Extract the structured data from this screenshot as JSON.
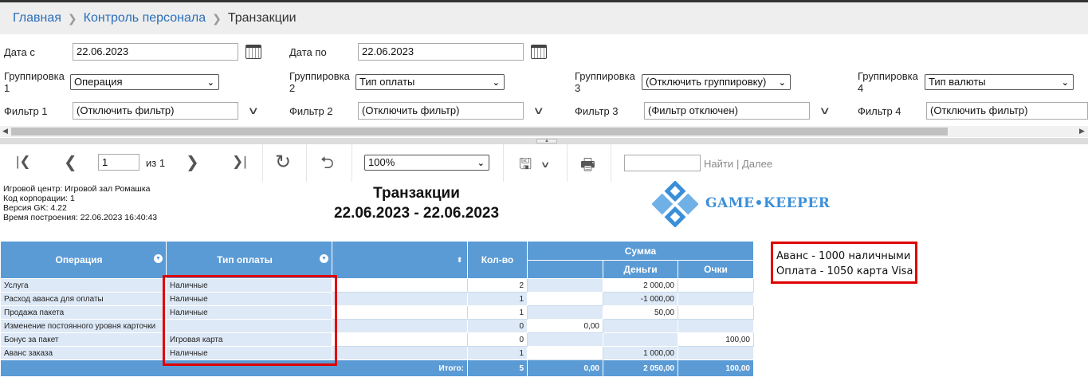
{
  "breadcrumb": {
    "home": "Главная",
    "section": "Контроль персонала",
    "current": "Транзакции"
  },
  "params": {
    "date_from_label": "Дата с",
    "date_from": "22.06.2023",
    "date_to_label": "Дата по",
    "date_to": "22.06.2023",
    "groupings": [
      {
        "label_a": "Группировка",
        "label_b": "1",
        "value": "Операция"
      },
      {
        "label_a": "Группировка",
        "label_b": "2",
        "value": "Тип оплаты"
      },
      {
        "label_a": "Группировка",
        "label_b": "3",
        "value": "(Отключить группировку)"
      },
      {
        "label_a": "Группировка",
        "label_b": "4",
        "value": "Тип валюты"
      }
    ],
    "filters": [
      {
        "label": "Фильтр 1",
        "value": "(Отключить фильтр)"
      },
      {
        "label": "Фильтр 2",
        "value": "(Отключить фильтр)"
      },
      {
        "label": "Фильтр 3",
        "value": "(Фильтр отключен)"
      },
      {
        "label": "Фильтр 4",
        "value": "(Отключить фильтр)"
      }
    ]
  },
  "toolbar": {
    "page": "1",
    "page_of": "из 1",
    "zoom": "100%",
    "find": "Найти",
    "find_sep": "|",
    "next": "Далее"
  },
  "report": {
    "club": "Игровой центр: Игровой зал Ромашка",
    "corp": "Код корпорации: 1",
    "version": "Версия GK: 4.22",
    "built": "Время построения: 22.06.2023 16:40:43",
    "title": "Транзакции",
    "period": "22.06.2023 - 22.06.2023",
    "logo": "GAME•KEEPER",
    "columns": {
      "operation": "Операция",
      "payment": "Тип оплаты",
      "count": "Кол-во",
      "sum": "Сумма",
      "money": "Деньги",
      "points": "Очки"
    },
    "rows": [
      {
        "op": "Услуга",
        "pay": "Наличные",
        "count": "2",
        "blank": "",
        "money": "2 000,00",
        "points": ""
      },
      {
        "op": "Расход аванса для оплаты",
        "pay": "Наличные",
        "count": "1",
        "blank": "",
        "money": "-1 000,00",
        "points": ""
      },
      {
        "op": "Продажа пакета",
        "pay": "Наличные",
        "count": "1",
        "blank": "",
        "money": "50,00",
        "points": ""
      },
      {
        "op": "Изменение постоянного уровня карточки",
        "pay": "",
        "count": "0",
        "blank": "0,00",
        "money": "",
        "points": ""
      },
      {
        "op": "Бонус за пакет",
        "pay": "Игровая карта",
        "count": "0",
        "blank": "",
        "money": "",
        "points": "100,00"
      },
      {
        "op": "Аванс заказа",
        "pay": "Наличные",
        "count": "1",
        "blank": "",
        "money": "1 000,00",
        "points": ""
      }
    ],
    "total": {
      "label": "Итого:",
      "count": "5",
      "blank": "0,00",
      "money": "2 050,00",
      "points": "100,00"
    }
  },
  "note": {
    "line1": "Аванс - 1000 наличными",
    "line2": "Оплата - 1050 карта Visa"
  },
  "colors": {
    "header_blue": "#5b9bd5",
    "row_blue": "#dde9f6",
    "highlight_red": "#e00000",
    "link": "#2a6ebb"
  }
}
